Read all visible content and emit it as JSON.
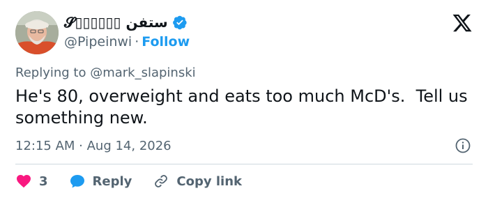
{
  "author": {
    "display_name": "𝓢▯▯▯▯▯▯ ستفن",
    "handle": "@Pipeinwi",
    "separator": "·",
    "follow_label": "Follow"
  },
  "replying": {
    "prefix": "Replying to ",
    "mention": "@mark_slapinski"
  },
  "tweet": {
    "text": "He's 80, overweight and eats too much McD's.  Tell us something new.",
    "timestamp": "12:15 AM · Aug 14, 2026"
  },
  "actions": {
    "like_count": "3",
    "reply_label": "Reply",
    "copy_link_label": "Copy link"
  },
  "colors": {
    "text_primary": "#0f1419",
    "text_secondary": "#536471",
    "accent": "#1d9bf0",
    "like": "#f91880",
    "divider": "#cfd9de"
  },
  "icons": [
    "verified-badge-icon",
    "x-logo-icon",
    "info-icon",
    "heart-icon",
    "reply-bubble-icon",
    "link-icon"
  ]
}
